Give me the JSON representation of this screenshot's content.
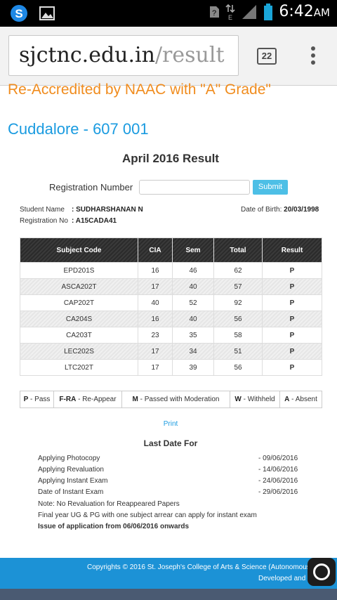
{
  "status": {
    "time": "6:42",
    "ampm": "AM"
  },
  "browser": {
    "url_domain": "sjctnc.edu.in",
    "url_path": "/result",
    "tab_count": "22"
  },
  "header": {
    "accreditation": "Re-Accredited by NAAC with \"A\" Grade\"",
    "city": "Cuddalore - 607 001"
  },
  "page": {
    "title": "April 2016 Result",
    "reg_label": "Registration Number",
    "submit_label": "Submit",
    "student_name_label": "Student Name",
    "student_name": ": SUDHARSHANAN N",
    "reg_no_label": "Registration No",
    "reg_no": ": A15CADA41",
    "dob_label": "Date of Birth:",
    "dob": "20/03/1998"
  },
  "results": {
    "headers": [
      "Subject Code",
      "CIA",
      "Sem",
      "Total",
      "Result"
    ],
    "rows": [
      [
        "EPD201S",
        "16",
        "46",
        "62",
        "P"
      ],
      [
        "ASCA202T",
        "17",
        "40",
        "57",
        "P"
      ],
      [
        "CAP202T",
        "40",
        "52",
        "92",
        "P"
      ],
      [
        "CA204S",
        "16",
        "40",
        "56",
        "P"
      ],
      [
        "CA203T",
        "23",
        "35",
        "58",
        "P"
      ],
      [
        "LEC202S",
        "17",
        "34",
        "51",
        "P"
      ],
      [
        "LTC202T",
        "17",
        "39",
        "56",
        "P"
      ]
    ]
  },
  "legend": [
    {
      "code": "P",
      "text": " - Pass"
    },
    {
      "code": "F-RA",
      "text": " - Re-Appear"
    },
    {
      "code": "M",
      "text": " - Passed with Moderation"
    },
    {
      "code": "W",
      "text": " - Withheld"
    },
    {
      "code": "A",
      "text": " - Absent"
    }
  ],
  "print_label": "Print",
  "last_date": {
    "title": "Last Date For",
    "items": [
      {
        "label": "Applying Photocopy",
        "date": "-  09/06/2016"
      },
      {
        "label": "Applying Revaluation",
        "date": "-  14/06/2016"
      },
      {
        "label": "Applying Instant Exam",
        "date": "-  24/06/2016"
      },
      {
        "label": "Date of Instant Exam",
        "date": "-  29/06/2016"
      }
    ],
    "note1": "Note: No Revaluation for Reappeared Papers",
    "note2": "Final year UG & PG with one subject arrear can apply for instant exam",
    "note3": "Issue of application from 06/06/2016 onwards"
  },
  "footer": {
    "line1": "Copyrights © 2016 St. Joseph's College of Arts & Science (Autonomous) C",
    "line2": "Developed and M"
  }
}
